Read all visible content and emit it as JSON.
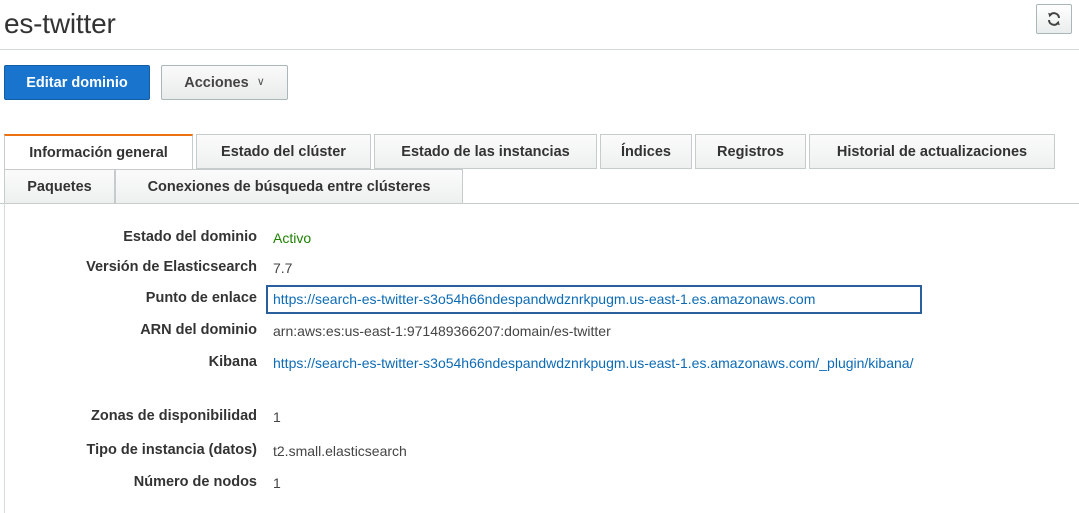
{
  "header": {
    "title": "es-twitter"
  },
  "actions": {
    "edit_label": "Editar dominio",
    "actions_label": "Acciones",
    "actions_caret": "∨"
  },
  "tabs": [
    {
      "label": "Información general",
      "active": true
    },
    {
      "label": "Estado del clúster",
      "active": false
    },
    {
      "label": "Estado de las instancias",
      "active": false
    },
    {
      "label": "Índices",
      "active": false
    },
    {
      "label": "Registros",
      "active": false
    },
    {
      "label": "Historial de actualizaciones",
      "active": false
    },
    {
      "label": "Paquetes",
      "active": false
    },
    {
      "label": "Conexiones de búsqueda entre clústeres",
      "active": false
    }
  ],
  "details": {
    "domain_status": {
      "label": "Estado del dominio",
      "value": "Activo"
    },
    "es_version": {
      "label": "Versión de Elasticsearch",
      "value": "7.7"
    },
    "endpoint": {
      "label": "Punto de enlace",
      "value": "https://search-es-twitter-s3o54h66ndespandwdznrkpugm.us-east-1.es.amazonaws.com"
    },
    "domain_arn": {
      "label": "ARN del dominio",
      "value": "arn:aws:es:us-east-1:971489366207:domain/es-twitter"
    },
    "kibana": {
      "label": "Kibana",
      "value": "https://search-es-twitter-s3o54h66ndespandwdznrkpugm.us-east-1.es.amazonaws.com/_plugin/kibana/"
    },
    "availability_zones": {
      "label": "Zonas de disponibilidad",
      "value": "1"
    },
    "instance_type": {
      "label": "Tipo de instancia (datos)",
      "value": "t2.small.elasticsearch"
    },
    "node_count": {
      "label": "Número de nodos",
      "value": "1"
    }
  },
  "colors": {
    "primary": "#1874cc",
    "active_tab_accent": "#ec7211",
    "status_active": "#1d8102",
    "link": "#0d6bb5"
  },
  "icons": {
    "refresh": "refresh-icon",
    "caret": "chevron-down-icon"
  }
}
